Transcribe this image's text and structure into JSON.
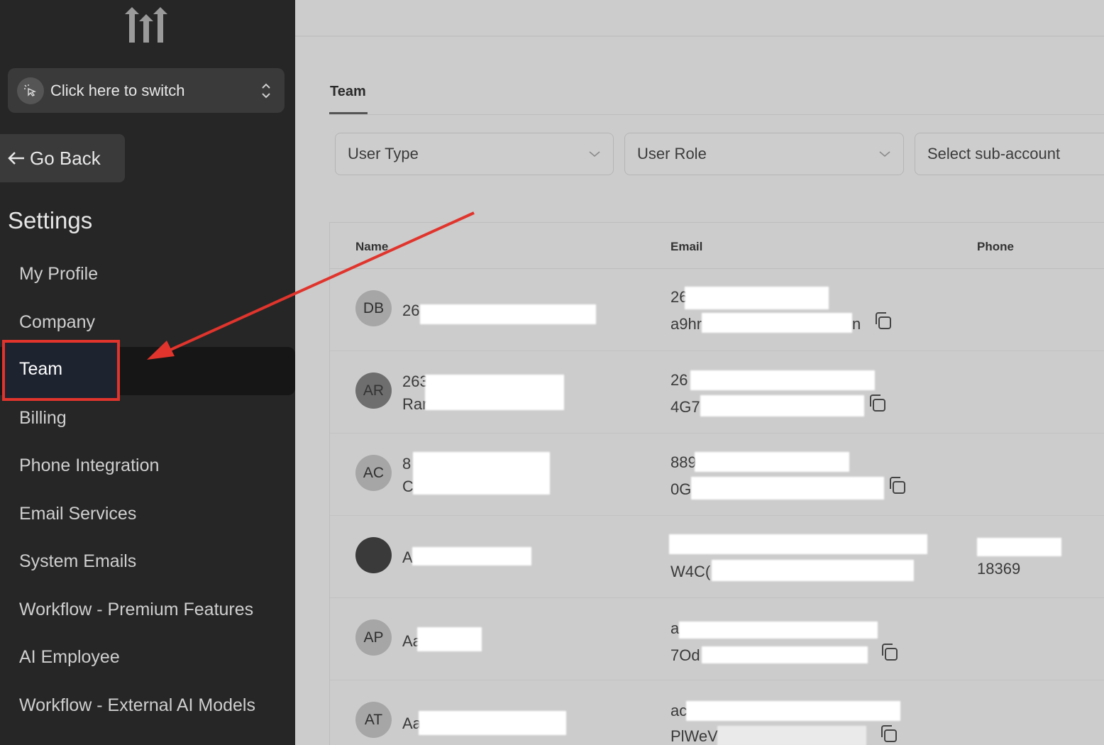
{
  "sidebar": {
    "switcher_label": "Click here to switch",
    "go_back_label": "Go Back",
    "settings_title": "Settings",
    "items": [
      {
        "label": "My Profile"
      },
      {
        "label": "Company"
      },
      {
        "label": "Team"
      },
      {
        "label": "Billing"
      },
      {
        "label": "Phone Integration"
      },
      {
        "label": "Email Services"
      },
      {
        "label": "System Emails"
      },
      {
        "label": "Workflow - Premium Features"
      },
      {
        "label": "AI Employee"
      },
      {
        "label": "Workflow - External AI Models"
      }
    ]
  },
  "main": {
    "tab_label": "Team",
    "filters": {
      "user_type": "User Type",
      "user_role": "User Role",
      "sub_account": "Select sub-account"
    },
    "columns": {
      "name": "Name",
      "email": "Email",
      "phone": "Phone"
    },
    "rows": [
      {
        "initials": "DB",
        "name1": "26",
        "name2": "",
        "email1": "26",
        "email2": "a9hr",
        "email2_tail": "n",
        "phone": ""
      },
      {
        "initials": "AR",
        "name1": "263",
        "name2": "Rar",
        "email1": "26",
        "email2": "4G7",
        "email2_tail": "",
        "phone": ""
      },
      {
        "initials": "AC",
        "name1": "8",
        "name2": "C",
        "email1": "889",
        "email2": "0G",
        "email2_tail": "",
        "phone": ""
      },
      {
        "initials": "",
        "name1": "A",
        "name2": "",
        "email1": "",
        "email2": "W4C(",
        "email2_tail": "",
        "phone": "18369"
      },
      {
        "initials": "AP",
        "name1": "Aa",
        "name2": "",
        "email1": "a",
        "email2": "7Od",
        "email2_tail": "",
        "phone": ""
      },
      {
        "initials": "AT",
        "name1": "Aa",
        "name2": "",
        "email1": "ac",
        "email2": "PlWeV",
        "email2_tail": "",
        "phone": ""
      }
    ]
  },
  "colors": {
    "highlight": "#e0342c",
    "sidebar_bg": "#262626",
    "main_bg": "#cccccc"
  }
}
